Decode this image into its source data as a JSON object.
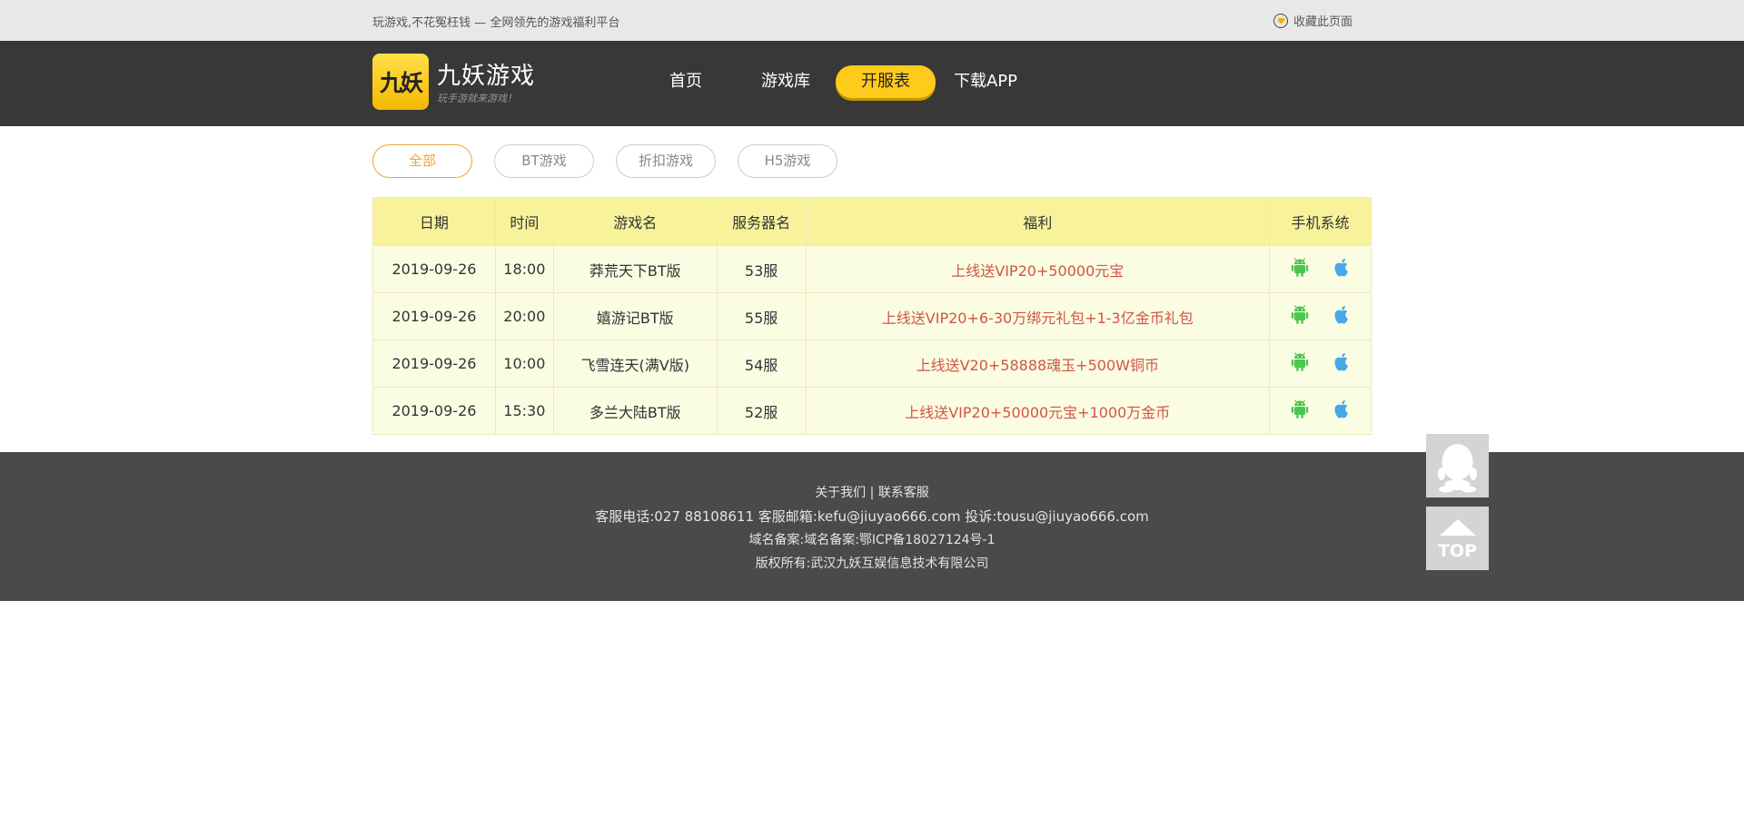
{
  "topbar": {
    "slogan": "玩游戏,不花冤枉钱 — 全网领先的游戏福利平台",
    "favorite": "收藏此页面"
  },
  "header": {
    "logo_mark": "九妖",
    "logo_title": "九妖游戏",
    "logo_sub": "玩手游就来游戏！",
    "nav": [
      {
        "label": "首页"
      },
      {
        "label": "游戏库"
      },
      {
        "label": "开服表"
      },
      {
        "label": "下载APP"
      }
    ]
  },
  "filters": [
    {
      "label": "全部"
    },
    {
      "label": "BT游戏"
    },
    {
      "label": "折扣游戏"
    },
    {
      "label": "H5游戏"
    }
  ],
  "table": {
    "headers": [
      "日期",
      "时间",
      "游戏名",
      "服务器名",
      "福利",
      "手机系统"
    ],
    "rows": [
      {
        "date": "2019-09-26",
        "time": "18:00",
        "game": "莽荒天下BT版",
        "server": "53服",
        "welfare": "上线送VIP20+50000元宝"
      },
      {
        "date": "2019-09-26",
        "time": "20:00",
        "game": "嬉游记BT版",
        "server": "55服",
        "welfare": "上线送VIP20+6-30万绑元礼包+1-3亿金币礼包"
      },
      {
        "date": "2019-09-26",
        "time": "10:00",
        "game": "飞雪连天(满V版)",
        "server": "54服",
        "welfare": "上线送V20+58888魂玉+500W铜币"
      },
      {
        "date": "2019-09-26",
        "time": "15:30",
        "game": "多兰大陆BT版",
        "server": "52服",
        "welfare": "上线送VIP20+50000元宝+1000万金币"
      }
    ]
  },
  "footer": {
    "about": "关于我们",
    "sep": "|",
    "contact": "联系客服",
    "phone_line": "客服电话:027 88108611 客服邮箱:kefu@jiuyao666.com 投诉:tousu@jiuyao666.com",
    "icp_line": "域名备案:域名备案:鄂ICP备18027124号-1",
    "copyright_line": "版权所有:武汉九妖互娱信息技术有限公司"
  },
  "side": {
    "top_label": "TOP"
  },
  "colors": {
    "accent_yellow": "#fecb1c",
    "header_bg": "#383838",
    "welfare_red": "#d05546",
    "android_green": "#4cc552",
    "apple_blue": "#46a8e8"
  }
}
